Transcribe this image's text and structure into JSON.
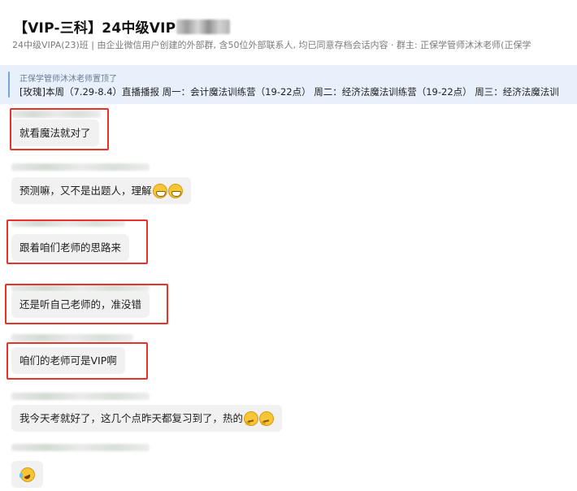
{
  "header": {
    "title": "【VIP-三科】24中级VIP",
    "subtitle": "24中级VIPA(23)班 | 由企业微信用户创建的外部群, 含50位外部联系人, 均已同意存档会话内容  · 群主: 正保学管师沐沐老师(正保学"
  },
  "pinned": {
    "note": "正保学管师沐沐老师置顶了",
    "text": "[玫瑰]本周（7.29-8.4）直播播报 周一：会计魔法训练营（19-22点） 周二：经济法魔法训练营（19-22点）  周三：经济法魔法训"
  },
  "messages": [
    {
      "text": "就看魔法就对了",
      "emojis": [],
      "highlighted": true
    },
    {
      "text": "预测嘛，又不是出题人，理解",
      "emojis": [
        "grin-icon",
        "grin-icon"
      ],
      "highlighted": false
    },
    {
      "text": "跟着咱们老师的思路来",
      "emojis": [],
      "highlighted": true
    },
    {
      "text": "还是听自己老师的，准没错",
      "emojis": [],
      "highlighted": true
    },
    {
      "text": "咱们的老师可是VIP啊",
      "emojis": [],
      "highlighted": true
    },
    {
      "text": "我今天考就好了，这几个点昨天都复习到了，热的",
      "emojis": [
        "thinking-icon",
        "thinking-icon"
      ],
      "highlighted": false
    },
    {
      "text": "",
      "emojis": [
        "laugh-cry-icon"
      ],
      "highlighted": false
    }
  ],
  "colors": {
    "highlight": "#e8322c",
    "bubble": "#f1f1f1",
    "pinned_bg": "#e8f0fb"
  }
}
